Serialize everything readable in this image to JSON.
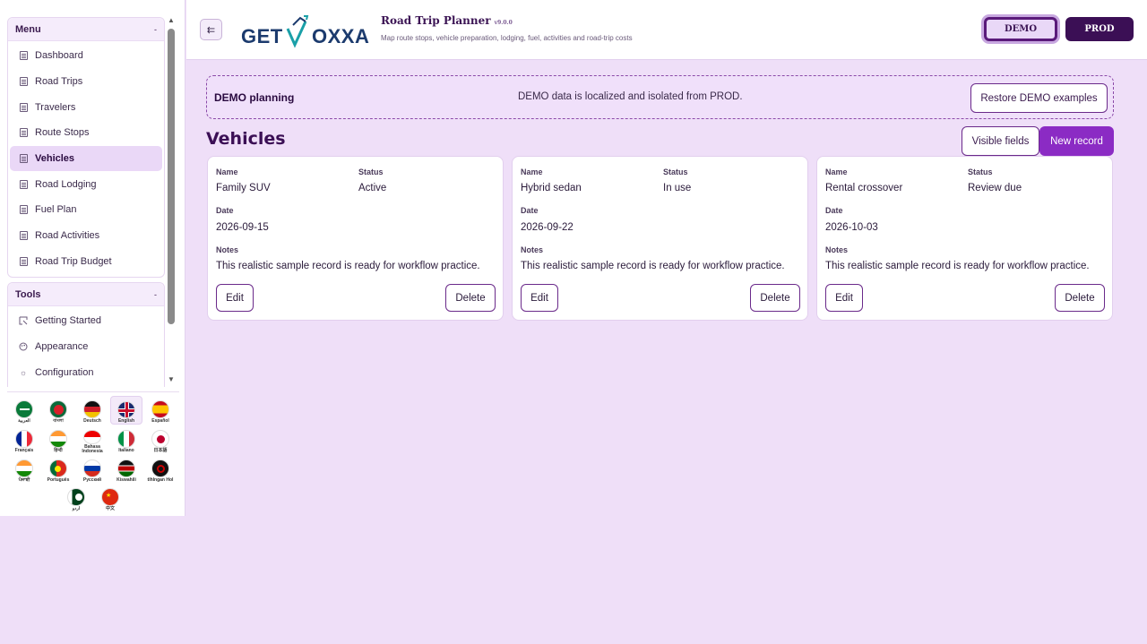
{
  "sidebar": {
    "menu_title": "Menu",
    "menu_items": [
      {
        "label": "Dashboard"
      },
      {
        "label": "Road Trips"
      },
      {
        "label": "Travelers"
      },
      {
        "label": "Route Stops"
      },
      {
        "label": "Vehicles",
        "active": true
      },
      {
        "label": "Road Lodging"
      },
      {
        "label": "Fuel Plan"
      },
      {
        "label": "Road Activities"
      },
      {
        "label": "Road Trip Budget"
      }
    ],
    "tools_title": "Tools",
    "tools_items": [
      {
        "label": "Getting Started",
        "icon": "guide-icon"
      },
      {
        "label": "Appearance",
        "icon": "palette-icon"
      },
      {
        "label": "Configuration",
        "icon": "gear-icon"
      }
    ],
    "collapse_glyph": "-"
  },
  "languages": [
    {
      "label": "العربية",
      "icon": "flag-saudi-arabia"
    },
    {
      "label": "বাংলা",
      "icon": "flag-bangladesh"
    },
    {
      "label": "Deutsch",
      "icon": "flag-germany"
    },
    {
      "label": "English",
      "icon": "flag-uk",
      "selected": true
    },
    {
      "label": "Español",
      "icon": "flag-spain"
    },
    {
      "label": "Français",
      "icon": "flag-france"
    },
    {
      "label": "हिन्दी",
      "icon": "flag-india"
    },
    {
      "label": "Bahasa Indonesia",
      "icon": "flag-indonesia"
    },
    {
      "label": "Italiano",
      "icon": "flag-italy"
    },
    {
      "label": "日本語",
      "icon": "flag-japan"
    },
    {
      "label": "ਪੰਜਾਬੀ",
      "icon": "flag-india-punjab"
    },
    {
      "label": "Português",
      "icon": "flag-portugal"
    },
    {
      "label": "Русский",
      "icon": "flag-russia"
    },
    {
      "label": "Kiswahili",
      "icon": "flag-kenya"
    },
    {
      "label": "tlhIngan Hol",
      "icon": "flag-klingon"
    },
    {
      "label": "اردو",
      "icon": "flag-pakistan"
    },
    {
      "label": "中文",
      "icon": "flag-china"
    }
  ],
  "header": {
    "collapse_icon": "sidebar-collapse-icon",
    "logo_text_left": "GET",
    "logo_text_right": "OXXA",
    "title": "Road Trip Planner",
    "version": "v9.0.0",
    "subtitle": "Map route stops, vehicle preparation, lodging, fuel, activities and road-trip costs",
    "demo_label": "DEMO",
    "prod_label": "PROD"
  },
  "banner": {
    "title": "DEMO planning",
    "message": "DEMO data is localized and isolated from PROD.",
    "restore_label": "Restore DEMO examples"
  },
  "section": {
    "title": "Vehicles",
    "visible_fields_label": "Visible fields",
    "new_record_label": "New record"
  },
  "field_labels": {
    "name": "Name",
    "status": "Status",
    "date": "Date",
    "notes": "Notes",
    "edit": "Edit",
    "delete": "Delete"
  },
  "records": [
    {
      "name": "Family SUV",
      "status": "Active",
      "date": "2026-09-15",
      "notes": "This realistic sample record is ready for workflow practice."
    },
    {
      "name": "Hybrid sedan",
      "status": "In use",
      "date": "2026-09-22",
      "notes": "This realistic sample record is ready for workflow practice."
    },
    {
      "name": "Rental crossover",
      "status": "Review due",
      "date": "2026-10-03",
      "notes": "This realistic sample record is ready for workflow practice."
    }
  ],
  "colors": {
    "accent": "#8b2bc4",
    "dark_purple": "#3b0f55",
    "background": "#efdff8"
  }
}
